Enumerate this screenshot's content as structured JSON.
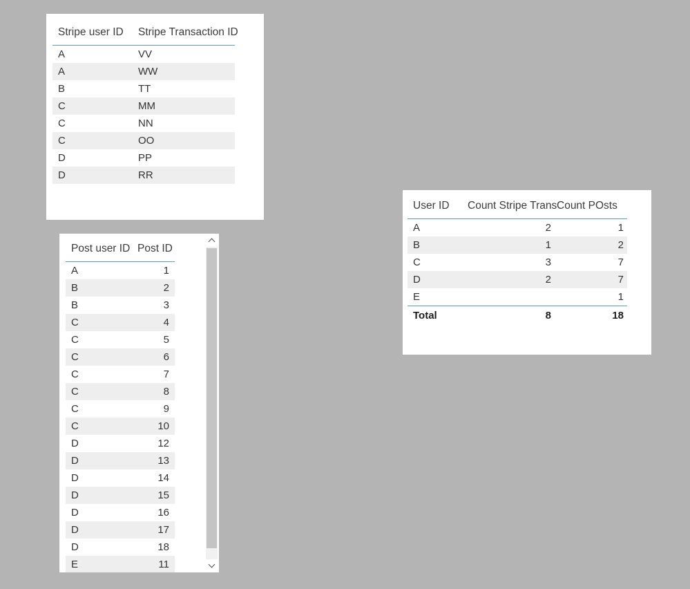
{
  "background_color": "#b4b4b4",
  "accent_rule_color": "#5c9db8",
  "zebra_row_color": "#eeeeee",
  "card_color": "#ffffff",
  "stripe_table": {
    "headers": [
      "Stripe user ID",
      "Stripe Transaction ID"
    ],
    "rows": [
      [
        "A",
        "VV"
      ],
      [
        "A",
        "WW"
      ],
      [
        "B",
        "TT"
      ],
      [
        "C",
        "MM"
      ],
      [
        "C",
        "NN"
      ],
      [
        "C",
        "OO"
      ],
      [
        "D",
        "PP"
      ],
      [
        "D",
        "RR"
      ]
    ]
  },
  "posts_table": {
    "headers": [
      "Post user ID",
      "Post ID"
    ],
    "rows": [
      [
        "A",
        "1"
      ],
      [
        "B",
        "2"
      ],
      [
        "B",
        "3"
      ],
      [
        "C",
        "4"
      ],
      [
        "C",
        "5"
      ],
      [
        "C",
        "6"
      ],
      [
        "C",
        "7"
      ],
      [
        "C",
        "8"
      ],
      [
        "C",
        "9"
      ],
      [
        "C",
        "10"
      ],
      [
        "D",
        "12"
      ],
      [
        "D",
        "13"
      ],
      [
        "D",
        "14"
      ],
      [
        "D",
        "15"
      ],
      [
        "D",
        "16"
      ],
      [
        "D",
        "17"
      ],
      [
        "D",
        "18"
      ],
      [
        "E",
        "11"
      ]
    ],
    "scrollbar": {
      "up_arrow": "chevron-up",
      "down_arrow": "chevron-down"
    }
  },
  "summary_table": {
    "headers": [
      "User ID",
      "Count Stripe Trans",
      "Count POsts"
    ],
    "rows": [
      [
        "A",
        "2",
        "1"
      ],
      [
        "B",
        "1",
        "2"
      ],
      [
        "C",
        "3",
        "7"
      ],
      [
        "D",
        "2",
        "7"
      ],
      [
        "E",
        "",
        "1"
      ]
    ],
    "total": [
      "Total",
      "8",
      "18"
    ]
  }
}
